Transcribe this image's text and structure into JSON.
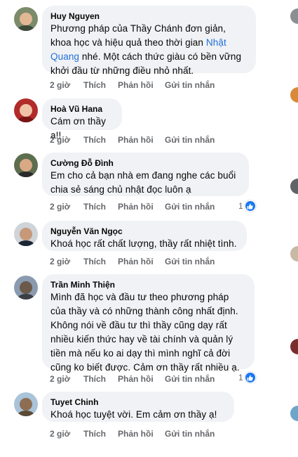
{
  "actions": {
    "like": "Thích",
    "reply": "Phản hồi",
    "send": "Gửi tin nhắn"
  },
  "comments": [
    {
      "author": "Huy Nguyen",
      "lines": [
        "Phương pháp của Thầy Chánh đơn giản,",
        "khoa học và hiệu quả theo thời gian "
      ],
      "link_line_rest": "nhé. Một cách thức giàu có bền vững",
      "link_part1": "Nhật",
      "link_part2": "Quang",
      "last_line": "khởi đầu từ những điều nhỏ nhất.",
      "time": "2 giờ"
    },
    {
      "author": "Hoà Vũ Hana",
      "lines": [
        "Cám ơn thầy ạ!!"
      ],
      "time": "2 giờ"
    },
    {
      "author": "Cường Đỗ Đình",
      "lines": [
        "Em cho cả bạn nhà em đang nghe các buổi",
        "chia sẻ sáng chủ nhật đọc luôn ạ"
      ],
      "time": "2 giờ",
      "reactions": "1"
    },
    {
      "author": "Nguyễn Văn Ngọc",
      "lines": [
        "Khoá học rất chất lượng, thầy rất nhiệt tình."
      ],
      "time": "2 giờ"
    },
    {
      "author": "Trần Minh Thiện",
      "lines": [
        "Mình đã học và đầu tư theo phương pháp",
        "của thầy và có những thành công nhất định.",
        "Không nói về đầu tư thì thầy cũng dạy rất",
        "nhiều kiến thức hay về tài chính và quản lý",
        "tiền mà nếu ko ai dạy thì mình nghĩ cả đời",
        "cũng ko biết được. Cảm ơn thầy rất nhiều ạ."
      ],
      "time": "2 giờ",
      "reactions": "1"
    },
    {
      "author": "Tuyet Chinh",
      "lines": [
        "Khoá học tuyệt vời. Em cảm ơn thầy ạ!"
      ],
      "time": "2 giờ"
    }
  ],
  "colors": {
    "bubble": "#f0f2f5",
    "link": "#216fdb",
    "meta": "#65676b",
    "like_blue": "#1877f2"
  },
  "icons": {
    "reaction": "like-thumbs-up-icon"
  }
}
